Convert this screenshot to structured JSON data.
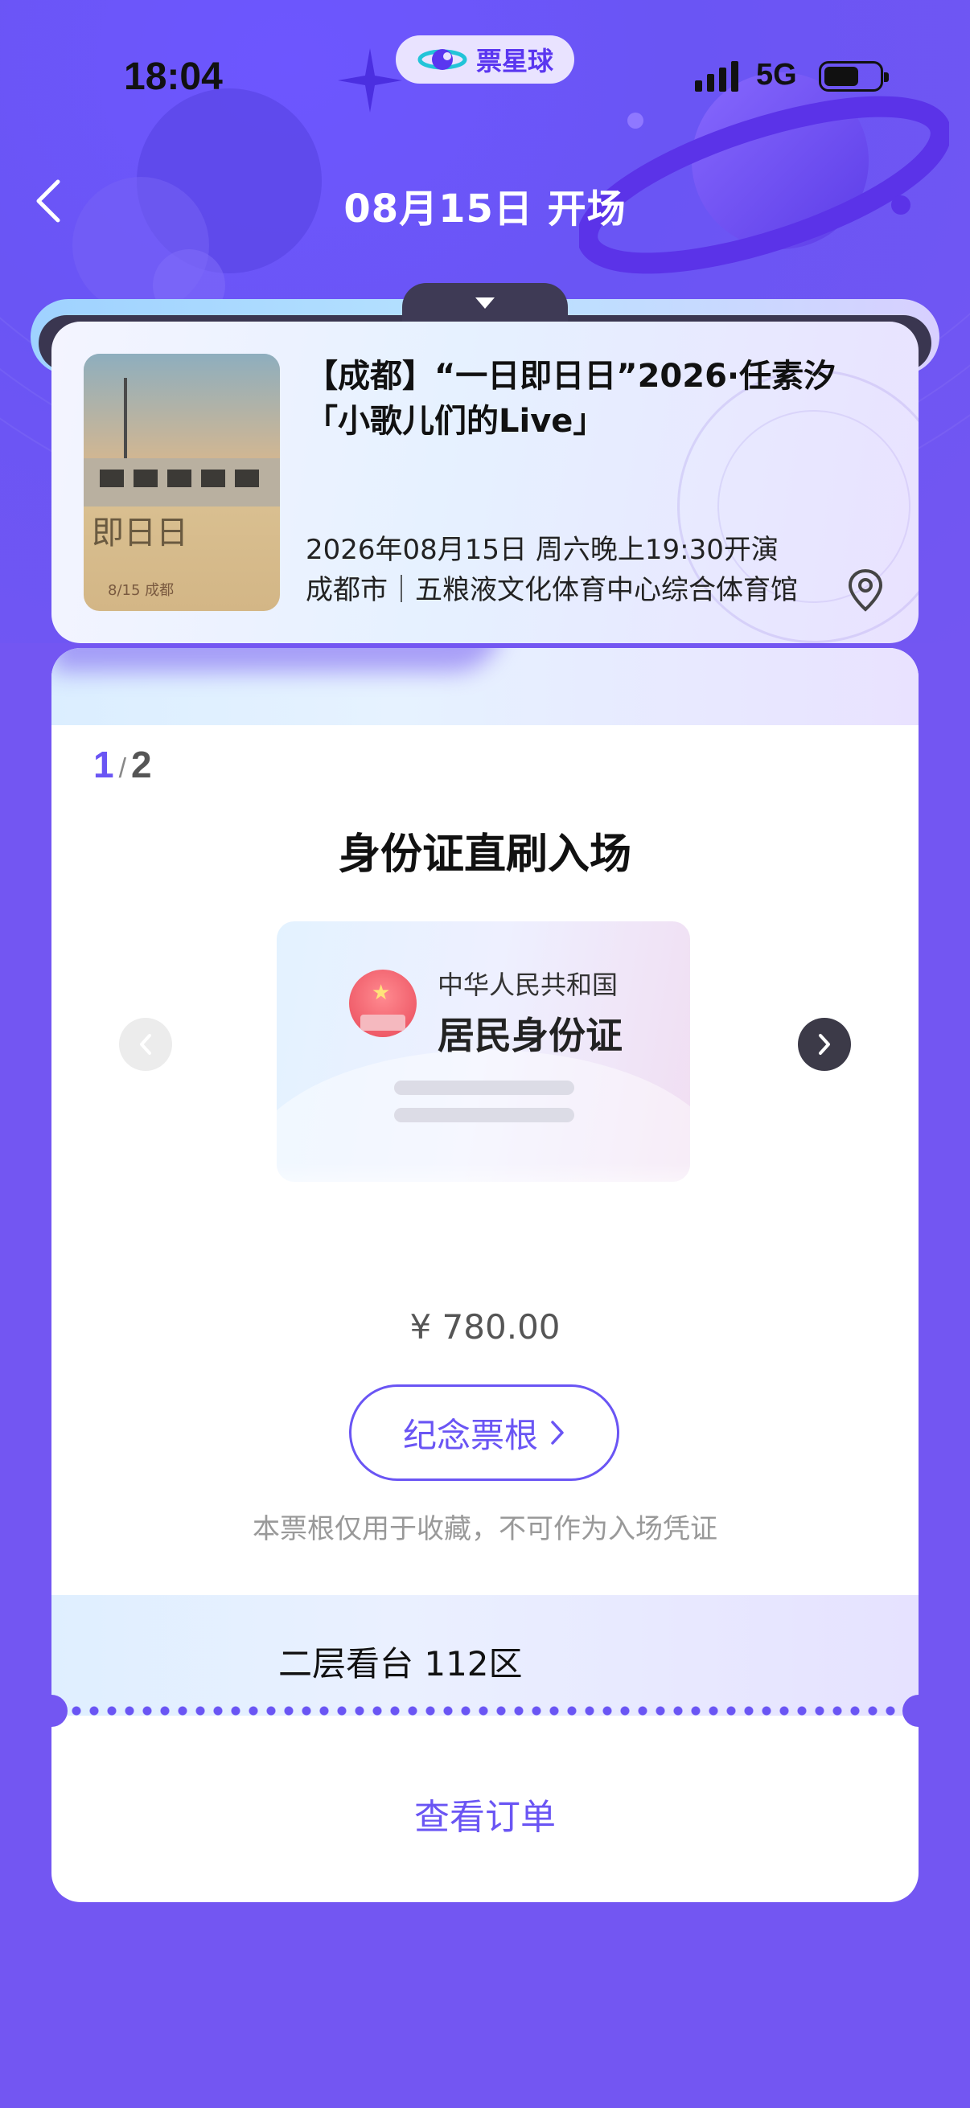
{
  "status_bar": {
    "time": "18:04",
    "network": "5G",
    "brand": "票星球"
  },
  "header": {
    "title": "08月15日 开场"
  },
  "event": {
    "title": "【成都】“一日即日日”2026·任素汐「小歌儿们的Live」",
    "datetime": "2026年08月15日 周六晚上19:30开演",
    "venue": "成都市｜五粮液文化体育中心综合体育馆",
    "poster_title": "即日日",
    "poster_date": "8/15 成都"
  },
  "ticket": {
    "page_current": "1",
    "page_separator": "/",
    "page_total": "2",
    "entry_method": "身份证直刷入场",
    "id_card_line1": "中华人民共和国",
    "id_card_line2": "居民身份证",
    "price": "¥ 780.00",
    "stub_button": "纪念票根",
    "stub_note": "本票根仅用于收藏，不可作为入场凭证",
    "seat": "二层看台 112区"
  },
  "footer": {
    "view_order": "查看订单"
  },
  "colors": {
    "accent": "#6a55f4",
    "background": "#7356f2"
  }
}
